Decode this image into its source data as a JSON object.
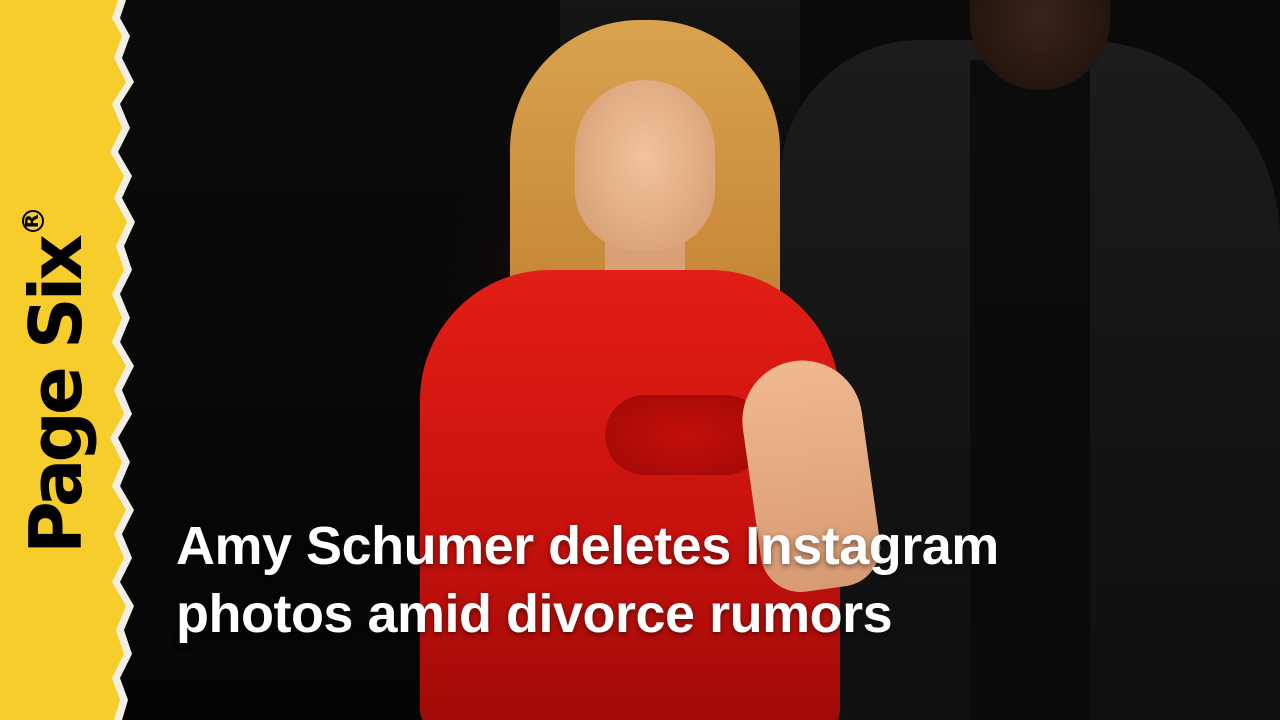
{
  "brand": {
    "logo_text": "Page Six",
    "logo_mark": "R",
    "band_color": "#f7cd2b"
  },
  "headline": {
    "line1": "Amy Schumer deletes Instagram",
    "line2": "photos amid divorce rumors"
  },
  "photo": {
    "dress_color": "#e21e16"
  }
}
